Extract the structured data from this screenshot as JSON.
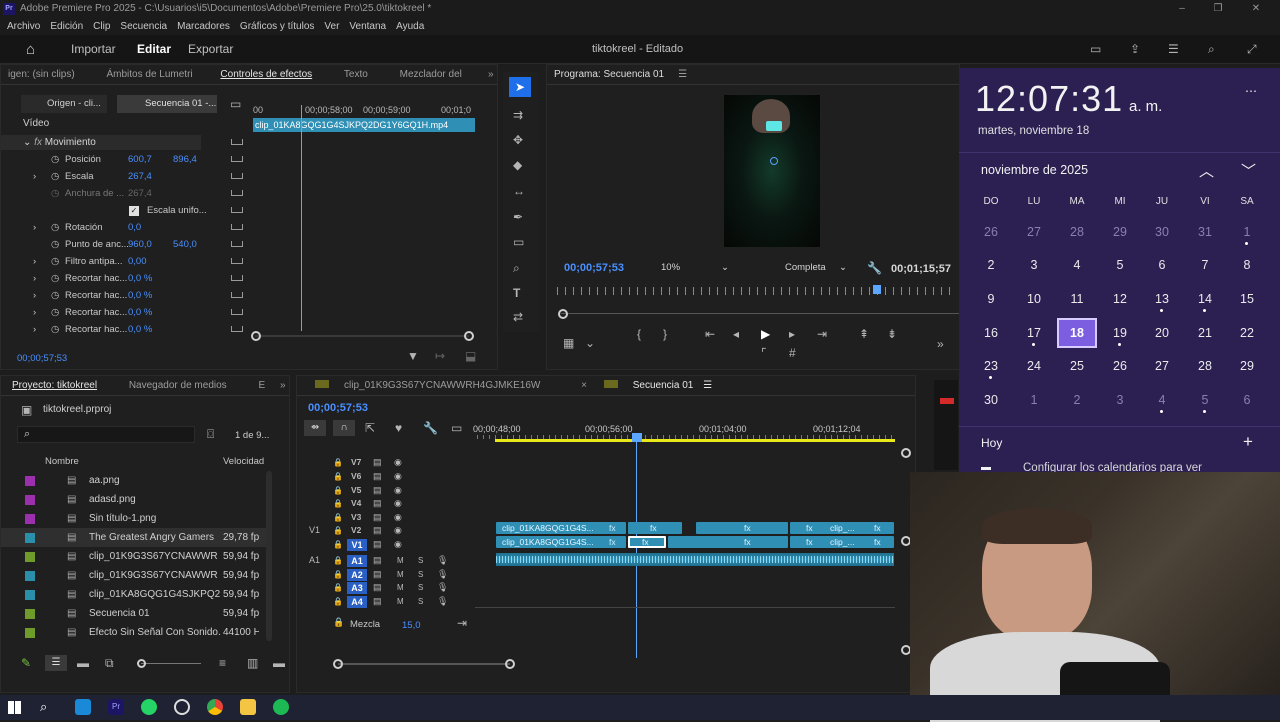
{
  "window": {
    "title": "Adobe Premiere Pro 2025 - C:\\Usuarios\\i5\\Documentos\\Adobe\\Premiere Pro\\25.0\\tiktokreel *",
    "app_icon": "Pr"
  },
  "menu": [
    "Archivo",
    "Edición",
    "Clip",
    "Secuencia",
    "Marcadores",
    "Gráficos y títulos",
    "Ver",
    "Ventana",
    "Ayuda"
  ],
  "header": {
    "home_icon": "home-icon",
    "nav": [
      "Importar",
      "Editar",
      "Exportar"
    ],
    "active_nav": "Editar",
    "project_title": "tiktokreel - Editado"
  },
  "effect_controls": {
    "tabs": [
      "igen: (sin clips)",
      "Ámbitos de Lumetri",
      "Controles de efectos",
      "Texto",
      "Mezclador del"
    ],
    "active_tab": "Controles de efectos",
    "source_btn": "Origen - cli...",
    "seq_btn": "Secuencia 01 -...",
    "ruler": [
      "00",
      "00;00;58;00",
      "00;00;59;00",
      "00;01;0"
    ],
    "clip_name": "clip_01KA8GQG1G4SJKPQ2DG1Y6GQ1H.mp4",
    "section": "Vídeo",
    "fx": "Movimiento",
    "rows": [
      {
        "label": "Posición",
        "v1": "600,7",
        "v2": "896,4"
      },
      {
        "label": "Escala",
        "v1": "267,4",
        "v2": ""
      },
      {
        "label": "Anchura de ...",
        "v1": "267,4",
        "v2": ""
      },
      {
        "label": "Escala unifo...",
        "v1": "",
        "v2": ""
      },
      {
        "label": "Rotación",
        "v1": "0,0",
        "v2": ""
      },
      {
        "label": "Punto de anc...",
        "v1": "960,0",
        "v2": "540,0"
      },
      {
        "label": "Filtro antipa...",
        "v1": "0,00",
        "v2": ""
      },
      {
        "label": "Recortar hac...",
        "v1": "0,0 %",
        "v2": ""
      },
      {
        "label": "Recortar hac...",
        "v1": "0,0 %",
        "v2": ""
      },
      {
        "label": "Recortar hac...",
        "v1": "0,0 %",
        "v2": ""
      },
      {
        "label": "Recortar hac...",
        "v1": "0,0 %",
        "v2": ""
      }
    ],
    "timecode": "00;00;57;53"
  },
  "program": {
    "title": "Programa: Secuencia 01",
    "timecode": "00;00;57;53",
    "zoom": "10%",
    "quality": "Completa",
    "duration": "00;01;15;57",
    "playhead_fraction": 0.8
  },
  "project": {
    "tabs": [
      "Proyecto: tiktokreel",
      "Navegador de medios",
      "E"
    ],
    "file": "tiktokreel.prproj",
    "count": "1 de 9...",
    "col_name": "Nombre",
    "col_rate": "Velocidad",
    "items": [
      {
        "name": "aa.png",
        "rate": "",
        "color": "#9b2fae"
      },
      {
        "name": "adasd.png",
        "rate": "",
        "color": "#9b2fae"
      },
      {
        "name": "Sin título-1.png",
        "rate": "",
        "color": "#9b2fae"
      },
      {
        "name": "The Greatest Angry Gamers",
        "rate": "29,78 fp",
        "color": "#2a8fa8"
      },
      {
        "name": "clip_01K9G3S67YCNAWWR",
        "rate": "59,94 fp",
        "color": "#6f9b2a"
      },
      {
        "name": "clip_01K9G3S67YCNAWWR",
        "rate": "59,94 fp",
        "color": "#2a8fa8"
      },
      {
        "name": "clip_01KA8GQG1G4SJKPQ2",
        "rate": "59,94 fp",
        "color": "#2a8fa8"
      },
      {
        "name": "Secuencia 01",
        "rate": "59,94 fp",
        "color": "#6f9b2a"
      },
      {
        "name": "Efecto Sin Señal Con Sonido.",
        "rate": "44100 H",
        "color": "#6f9b2a"
      }
    ]
  },
  "timeline": {
    "tabs": [
      "clip_01K9G3S67YCNAWWRH4GJMKE16W",
      "Secuencia 01"
    ],
    "timecode": "00;00;57;53",
    "ruler": [
      "00;00;48;00",
      "00;00;56;00",
      "00;01;04;00",
      "00;01;12;04"
    ],
    "video_tracks": [
      "V7",
      "V6",
      "V5",
      "V4",
      "V3",
      "V2",
      "V1"
    ],
    "audio_tracks": [
      "A1",
      "A2",
      "A3",
      "A4"
    ],
    "source_v": "V1",
    "source_a": "A1",
    "mix_label": "Mezcla",
    "mix_value": "15,0",
    "clip_label": "clip_01KA8GQG1G4S...",
    "clip_label_short": "clip_...",
    "fx": "fx"
  },
  "clock": {
    "time": "12:07:31",
    "ampm": "a. m.",
    "date": "martes, noviembre 18",
    "month": "noviembre de 2025",
    "weekdays": [
      "DO",
      "LU",
      "MA",
      "MI",
      "JU",
      "VI",
      "SA"
    ],
    "weeks": [
      [
        "26",
        "27",
        "28",
        "29",
        "30",
        "31",
        "1"
      ],
      [
        "2",
        "3",
        "4",
        "5",
        "6",
        "7",
        "8"
      ],
      [
        "9",
        "10",
        "11",
        "12",
        "13",
        "14",
        "15"
      ],
      [
        "16",
        "17",
        "18",
        "19",
        "20",
        "21",
        "22"
      ],
      [
        "23",
        "24",
        "25",
        "26",
        "27",
        "28",
        "29"
      ],
      [
        "30",
        "1",
        "2",
        "3",
        "4",
        "5",
        "6"
      ]
    ],
    "today": "18",
    "agenda_label": "Hoy",
    "config_text": "Configurar los calendarios para ver"
  },
  "colors": {
    "accent_blue": "#2f8fb5",
    "calendar_bg": "#2c1f52",
    "today_bg": "#7b5fe0",
    "playhead": "#5ba6ff"
  }
}
